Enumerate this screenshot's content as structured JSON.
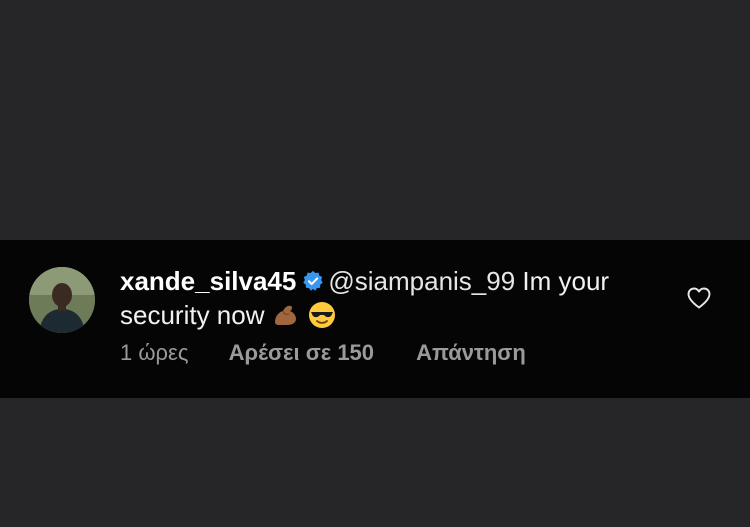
{
  "comment": {
    "username": "xande_silva45",
    "mention": "@siampanis_99",
    "text": " Im your security now",
    "emojis": [
      "flexed-biceps-icon",
      "sunglasses-face-icon"
    ],
    "time": "1 ώρες",
    "likes": "Αρέσει σε 150",
    "reply": "Απάντηση"
  },
  "icons": {
    "verified": "verified-badge-icon",
    "like": "heart-outline-icon"
  },
  "colors": {
    "background": "#262628",
    "comment_background": "#050505",
    "verified_blue": "#3897f0",
    "meta_text": "#9a9a9a"
  }
}
